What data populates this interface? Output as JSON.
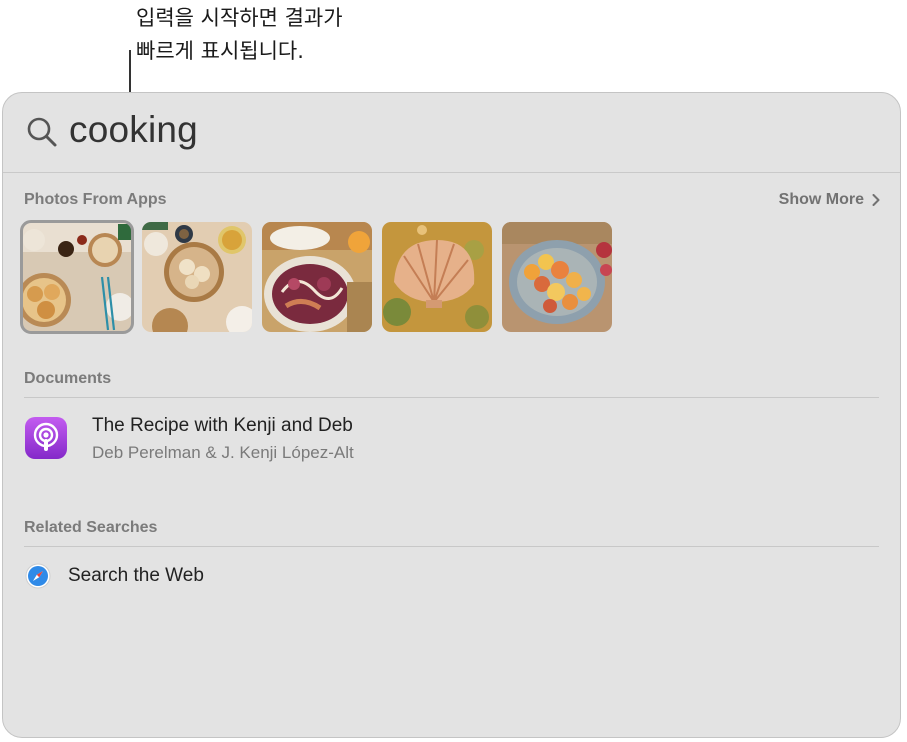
{
  "annotation": {
    "line1": "입력을 시작하면 결과가",
    "line2": "빠르게 표시됩니다."
  },
  "search": {
    "query": "cooking",
    "icon": "magnifying-glass-icon"
  },
  "photos_section": {
    "title": "Photos From Apps",
    "show_more": "Show More",
    "photos": [
      {
        "subject": "dumplings",
        "selected": true
      },
      {
        "subject": "dumplings-bowl",
        "selected": false
      },
      {
        "subject": "radicchio-salad",
        "selected": false
      },
      {
        "subject": "scallop-pie",
        "selected": false
      },
      {
        "subject": "citrus-platter",
        "selected": false
      }
    ]
  },
  "documents_section": {
    "title": "Documents",
    "items": [
      {
        "icon": "podcasts-icon",
        "title": "The Recipe with Kenji and Deb",
        "subtitle": "Deb Perelman & J. Kenji López-Alt"
      }
    ]
  },
  "related_section": {
    "title": "Related Searches",
    "items": [
      {
        "icon": "safari-icon",
        "label": "Search the Web"
      }
    ]
  },
  "colors": {
    "panel_bg": "#e3e3e3",
    "section_title": "#7b7b7b",
    "podcast_gradient_top": "#c35cf0",
    "podcast_gradient_bottom": "#8429c9",
    "safari_blue": "#2f8ae8"
  }
}
